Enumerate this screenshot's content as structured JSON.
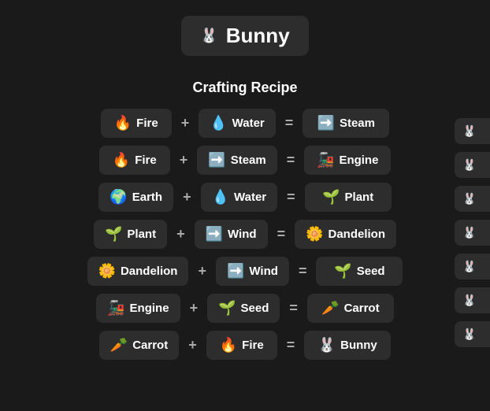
{
  "header": {
    "title": "Bunny",
    "icon": "🐰"
  },
  "section": {
    "title": "Crafting Recipe"
  },
  "recipes": [
    {
      "ingredient1": {
        "emoji": "🔥",
        "label": "Fire"
      },
      "operator1": "+",
      "ingredient2": {
        "emoji": "💧",
        "label": "Water"
      },
      "operator2": "=",
      "result": {
        "emoji": "➡️",
        "label": "Steam"
      }
    },
    {
      "ingredient1": {
        "emoji": "🔥",
        "label": "Fire"
      },
      "operator1": "+",
      "ingredient2": {
        "emoji": "➡️",
        "label": "Steam"
      },
      "operator2": "=",
      "result": {
        "emoji": "🚂",
        "label": "Engine"
      }
    },
    {
      "ingredient1": {
        "emoji": "🌍",
        "label": "Earth"
      },
      "operator1": "+",
      "ingredient2": {
        "emoji": "💧",
        "label": "Water"
      },
      "operator2": "=",
      "result": {
        "emoji": "🌱",
        "label": "Plant"
      }
    },
    {
      "ingredient1": {
        "emoji": "🌱",
        "label": "Plant"
      },
      "operator1": "+",
      "ingredient2": {
        "emoji": "➡️",
        "label": "Wind"
      },
      "operator2": "=",
      "result": {
        "emoji": "🌼",
        "label": "Dandelion"
      }
    },
    {
      "ingredient1": {
        "emoji": "🌼",
        "label": "Dandelion"
      },
      "operator1": "+",
      "ingredient2": {
        "emoji": "➡️",
        "label": "Wind"
      },
      "operator2": "=",
      "result": {
        "emoji": "🌱",
        "label": "Seed"
      }
    },
    {
      "ingredient1": {
        "emoji": "🚂",
        "label": "Engine"
      },
      "operator1": "+",
      "ingredient2": {
        "emoji": "🌱",
        "label": "Seed"
      },
      "operator2": "=",
      "result": {
        "emoji": "🥕",
        "label": "Carrot"
      }
    },
    {
      "ingredient1": {
        "emoji": "🥕",
        "label": "Carrot"
      },
      "operator1": "+",
      "ingredient2": {
        "emoji": "🔥",
        "label": "Fire"
      },
      "operator2": "=",
      "result": {
        "emoji": "🐰",
        "label": "Bunny"
      }
    }
  ],
  "sidebar": {
    "items": [
      "🐰",
      "🐰",
      "🐰",
      "🐰",
      "🐰",
      "🐰",
      "🐰"
    ]
  }
}
